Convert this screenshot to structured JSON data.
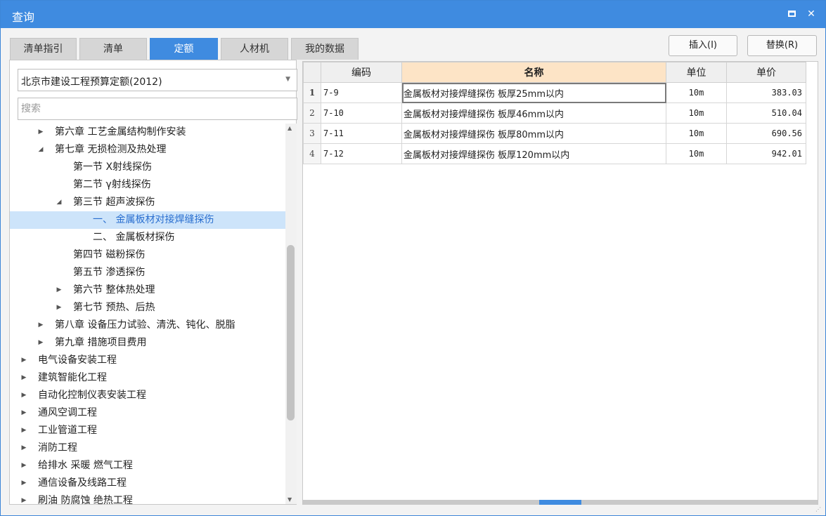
{
  "window": {
    "title": "查询",
    "maximize_label": "",
    "close_label": "✕"
  },
  "tabs": [
    {
      "label": "清单指引"
    },
    {
      "label": "清单"
    },
    {
      "label": "定额",
      "active": true
    },
    {
      "label": "人材机"
    },
    {
      "label": "我的数据"
    }
  ],
  "buttons": {
    "insert": "插入(I)",
    "replace": "替换(R)"
  },
  "left": {
    "library_select": "北京市建设工程预算定额(2012)",
    "search_placeholder": "搜索",
    "tree": [
      {
        "label": "第六章 工艺金属结构制作安装",
        "expander": "▶",
        "level": 1
      },
      {
        "label": "第七章 无损检测及热处理",
        "expander": "◢",
        "level": 1
      },
      {
        "label": "第一节 X射线探伤",
        "expander": "",
        "level": 2
      },
      {
        "label": "第二节 γ射线探伤",
        "expander": "",
        "level": 2
      },
      {
        "label": "第三节 超声波探伤",
        "expander": "◢",
        "level": 2
      },
      {
        "label": "一、 金属板材对接焊缝探伤",
        "expander": "",
        "level": 3,
        "selected": true
      },
      {
        "label": "二、 金属板材探伤",
        "expander": "",
        "level": 3
      },
      {
        "label": "第四节 磁粉探伤",
        "expander": "",
        "level": 2
      },
      {
        "label": "第五节 渗透探伤",
        "expander": "",
        "level": 2
      },
      {
        "label": "第六节 整体热处理",
        "expander": "▶",
        "level": 2
      },
      {
        "label": "第七节 预热、后热",
        "expander": "▶",
        "level": 2
      },
      {
        "label": "第八章 设备压力试验、清洗、钝化、脱脂",
        "expander": "▶",
        "level": 1
      },
      {
        "label": "第九章 措施项目费用",
        "expander": "▶",
        "level": 1
      },
      {
        "label": "电气设备安装工程",
        "expander": "▶",
        "level": 0
      },
      {
        "label": "建筑智能化工程",
        "expander": "▶",
        "level": 0
      },
      {
        "label": "自动化控制仪表安装工程",
        "expander": "▶",
        "level": 0
      },
      {
        "label": "通风空调工程",
        "expander": "▶",
        "level": 0
      },
      {
        "label": "工业管道工程",
        "expander": "▶",
        "level": 0
      },
      {
        "label": "消防工程",
        "expander": "▶",
        "level": 0
      },
      {
        "label": "给排水 采暖 燃气工程",
        "expander": "▶",
        "level": 0
      },
      {
        "label": "通信设备及线路工程",
        "expander": "▶",
        "level": 0
      },
      {
        "label": "刷油 防腐蚀 绝热工程",
        "expander": "▶",
        "level": 0
      }
    ]
  },
  "grid": {
    "columns": [
      "",
      "编码",
      "名称",
      "单位",
      "单价"
    ],
    "rows": [
      {
        "num": "1",
        "code": "7-9",
        "name": "金属板材对接焊缝探伤 板厚25mm以内",
        "unit": "10m",
        "price": "383.03"
      },
      {
        "num": "2",
        "code": "7-10",
        "name": "金属板材对接焊缝探伤 板厚46mm以内",
        "unit": "10m",
        "price": "510.04"
      },
      {
        "num": "3",
        "code": "7-11",
        "name": "金属板材对接焊缝探伤 板厚80mm以内",
        "unit": "10m",
        "price": "690.56"
      },
      {
        "num": "4",
        "code": "7-12",
        "name": "金属板材对接焊缝探伤 板厚120mm以内",
        "unit": "10m",
        "price": "942.01"
      }
    ]
  },
  "colors": {
    "accent": "#3f8be0",
    "header_highlight": "#fde4c6",
    "selection": "#cde4fa"
  }
}
